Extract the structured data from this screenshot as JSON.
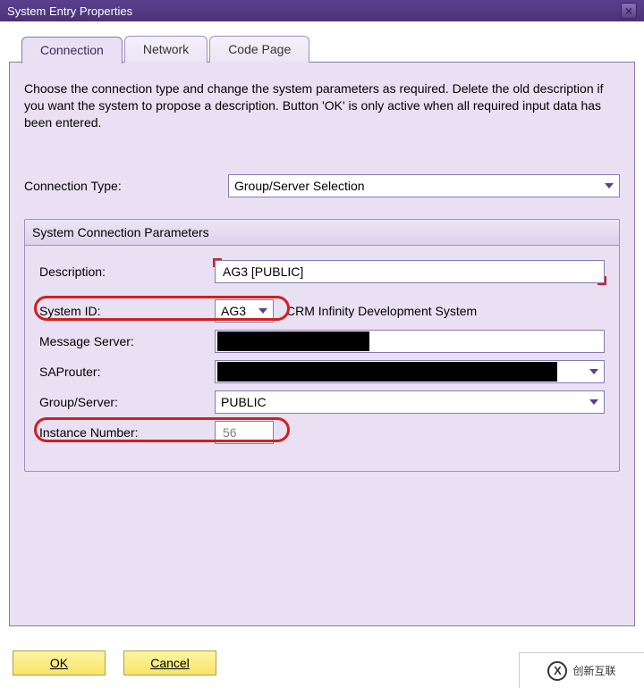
{
  "window": {
    "title": "System Entry Properties"
  },
  "tabs": [
    {
      "label": "Connection"
    },
    {
      "label": "Network"
    },
    {
      "label": "Code Page"
    }
  ],
  "intro": "Choose the connection type and change the system parameters as required. Delete the old description if you want the system to propose a description. Button 'OK' is only active when all required input data has been entered.",
  "connection": {
    "type_label": "Connection Type:",
    "type_value": "Group/Server Selection"
  },
  "group": {
    "title": "System Connection Parameters",
    "description_label": "Description:",
    "description_value": "AG3 [PUBLIC]",
    "system_id_label": "System ID:",
    "system_id_value": "AG3",
    "system_id_text": "CRM Infinity Development System",
    "message_server_label": "Message Server:",
    "saprouter_label": "SAProuter:",
    "group_server_label": "Group/Server:",
    "group_server_value": "PUBLIC",
    "instance_number_label": "Instance Number:",
    "instance_number_value": "56"
  },
  "buttons": {
    "ok": "OK",
    "cancel": "Cancel"
  },
  "watermark": "创新互联"
}
